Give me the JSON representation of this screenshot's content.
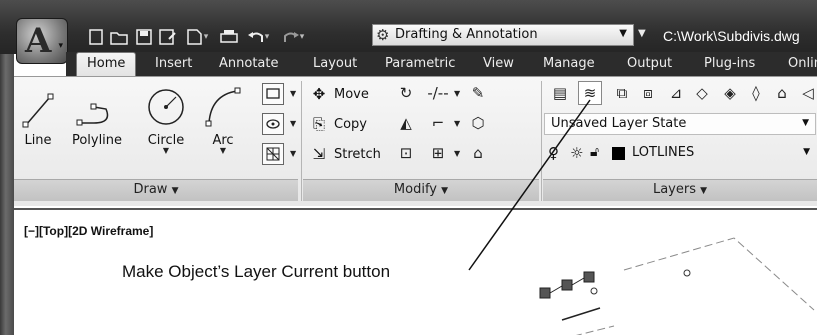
{
  "app": {
    "logo_letter": "A",
    "workspace_label": "Drafting & Annotation",
    "file_title": "C:\\Work\\Subdivis.dwg"
  },
  "quick_access": [
    {
      "name": "new-icon"
    },
    {
      "name": "open-icon"
    },
    {
      "name": "save-icon"
    },
    {
      "name": "save-as-icon"
    },
    {
      "name": "publish-icon"
    },
    {
      "name": "plot-icon"
    },
    {
      "name": "undo-icon"
    },
    {
      "name": "redo-icon"
    }
  ],
  "tabs": [
    {
      "label": "Home",
      "active": true
    },
    {
      "label": "Insert"
    },
    {
      "label": "Annotate"
    },
    {
      "label": "Layout"
    },
    {
      "label": "Parametric"
    },
    {
      "label": "View"
    },
    {
      "label": "Manage"
    },
    {
      "label": "Output"
    },
    {
      "label": "Plug-ins"
    },
    {
      "label": "Onlin"
    }
  ],
  "draw_panel": {
    "title": "Draw",
    "caret": "▼",
    "buttons": [
      {
        "label": "Line"
      },
      {
        "label": "Polyline"
      },
      {
        "label": "Circle"
      },
      {
        "label": "Arc"
      }
    ]
  },
  "modify_panel": {
    "title": "Modify",
    "caret": "▼",
    "move_label": "Move",
    "copy_label": "Copy",
    "stretch_label": "Stretch"
  },
  "layers_panel": {
    "title": "Layers",
    "caret": "▼",
    "layer_state": "Unsaved Layer State",
    "current_layer": "LOTLINES"
  },
  "drawing": {
    "viewport_label": "[−][Top][2D Wireframe]",
    "annotation": "Make Object’s Layer Current button"
  },
  "colors": {
    "titlebar": "#2e2e2e",
    "ribbon": "#ececec",
    "layer_swatch": "#000000"
  }
}
